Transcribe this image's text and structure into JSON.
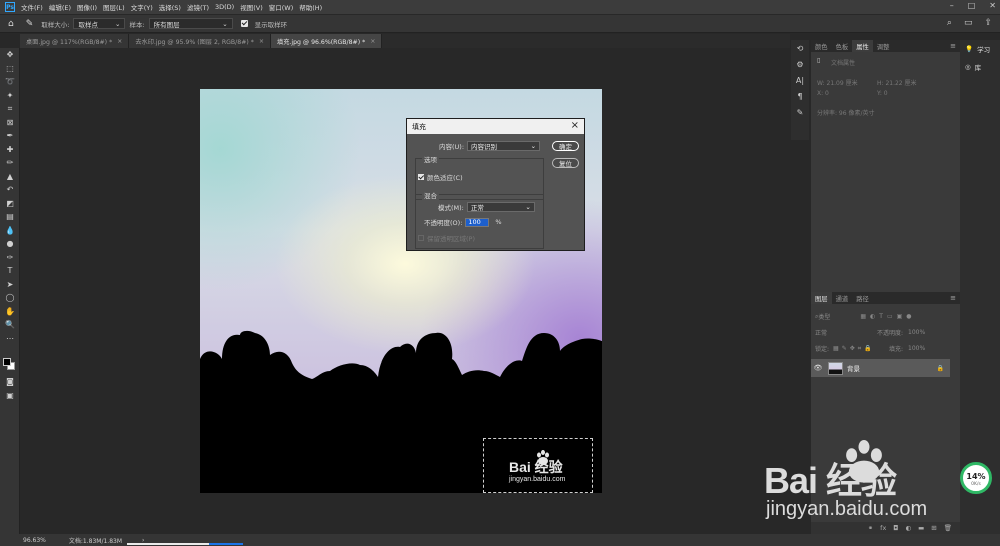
{
  "app": {
    "logo_text": "Ps",
    "menu": [
      "文件(F)",
      "编辑(E)",
      "图像(I)",
      "图层(L)",
      "文字(Y)",
      "选择(S)",
      "滤镜(T)",
      "3D(D)",
      "视图(V)",
      "窗口(W)",
      "帮助(H)"
    ]
  },
  "options_bar": {
    "sample_size_label": "取样大小:",
    "sample_size_value": "取样点",
    "sample_label": "样本:",
    "sample_value": "所有图层",
    "show_ring_label": "显示取样环"
  },
  "tabs": [
    {
      "label": "桌面.jpg @ 117%(RGB/8#) *"
    },
    {
      "label": "去水印.jpg @ 95.9% (图层 2, RGB/8#) *"
    },
    {
      "label": "填充.jpg @ 96.6%(RGB/8#) *",
      "active": true
    }
  ],
  "fill_dialog": {
    "title": "填充",
    "content_label": "内容(U):",
    "content_value": "内容识别",
    "ok_label": "确定",
    "reset_label": "复位",
    "options_group": "选项",
    "color_adapt_label": "颜色适应(C)",
    "blend_group": "混合",
    "mode_label": "模式(M):",
    "mode_value": "正常",
    "opacity_label": "不透明度(O):",
    "opacity_value": "100",
    "opacity_unit": "%",
    "preserve_label": "保留透明区域(P)"
  },
  "canvas_watermark": {
    "main": "Bai  经验",
    "sub": "jingyan.baidu.com"
  },
  "properties_panel": {
    "tabs": [
      "颜色",
      "色板",
      "属性",
      "调整"
    ],
    "active_tab": "属性",
    "doc_props": "文档属性",
    "w": "W: 21.09 厘米",
    "h": "H: 21.22 厘米",
    "x": "X: 0",
    "y": "Y: 0",
    "resolution": "分辨率: 96 像素/英寸"
  },
  "layers_panel": {
    "tabs": [
      "图层",
      "通道",
      "路径"
    ],
    "active_tab": "图层",
    "filter_type": "类型",
    "blend_mode": "正常",
    "opacity_label": "不透明度:",
    "opacity_value": "100%",
    "lock_label": "锁定:",
    "fill_label": "填充:",
    "fill_value": "100%",
    "layer_name": "背景"
  },
  "right_strip": {
    "learn": "学习",
    "library": "库"
  },
  "status": {
    "zoom": "96.63%",
    "doc": "文档:1.83M/1.83M"
  },
  "progress": {
    "fill": 0.29
  },
  "speed_widget": {
    "percent": "14%",
    "rate": "0K/s"
  },
  "big_watermark": {
    "main": "Bai  经验",
    "sub": "jingyan.baidu.com"
  },
  "colors": {
    "accent": "#31a8ff",
    "speed_ring": "#2fb865"
  }
}
